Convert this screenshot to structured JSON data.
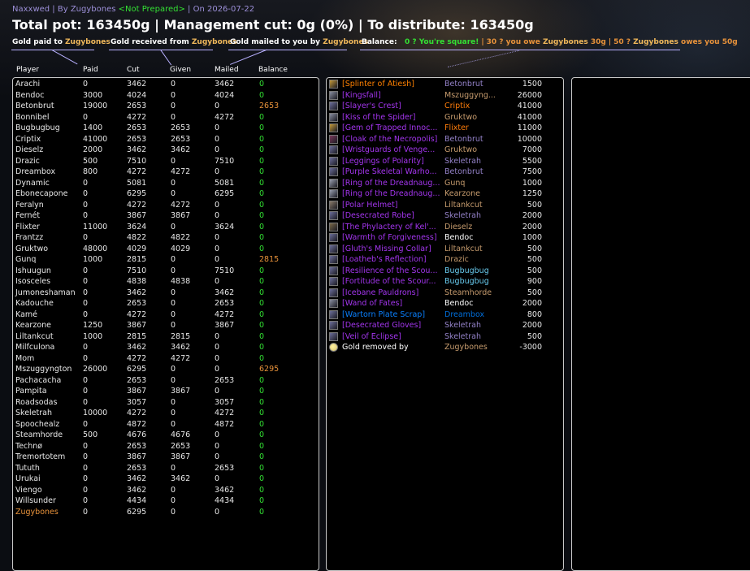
{
  "header": {
    "raid": "Naxxwed",
    "by_prefix": " | By ",
    "leader": "Zugybones",
    "status": "<Not Prepared>",
    "date": " | On 2026-07-22",
    "summary": "Total pot: 163450g | Management cut: 0g (0%) | To distribute: 163450g"
  },
  "legend": {
    "paid_prefix": "Gold paid to ",
    "paid_name": "Zugybones",
    "received_prefix": "Gold received from ",
    "received_name": "Zugybones",
    "mailed_prefix": "Gold mailed to you by ",
    "mailed_name": "Zugybones",
    "balance_label": "Balance:",
    "square": "0 ? You're square!",
    "owe_prefix": "30 ? you owe ",
    "owe_name": "Zugybones",
    "owe_suffix": " 30g",
    "owed_prefix": "50 ? ",
    "owed_name": "Zugybones",
    "owed_suffix": " owes you 50g",
    "sep": "|"
  },
  "columns": {
    "player": "Player",
    "paid": "Paid",
    "cut": "Cut",
    "given": "Given",
    "mailed": "Mailed",
    "balance": "Balance"
  },
  "players": [
    {
      "name": "Arachi",
      "paid": "0",
      "cut": "3462",
      "given": "0",
      "mailed": "3462",
      "balance": "0",
      "bal_color": "green"
    },
    {
      "name": "Bendoc",
      "paid": "3000",
      "cut": "4024",
      "given": "0",
      "mailed": "4024",
      "balance": "0",
      "bal_color": "green"
    },
    {
      "name": "Betonbrut",
      "paid": "19000",
      "cut": "2653",
      "given": "0",
      "mailed": "0",
      "balance": "2653",
      "bal_color": "orange"
    },
    {
      "name": "Bonnibel",
      "paid": "0",
      "cut": "4272",
      "given": "0",
      "mailed": "4272",
      "balance": "0",
      "bal_color": "green"
    },
    {
      "name": "Bugbugbug",
      "paid": "1400",
      "cut": "2653",
      "given": "2653",
      "mailed": "0",
      "balance": "0",
      "bal_color": "green"
    },
    {
      "name": "Criptix",
      "paid": "41000",
      "cut": "2653",
      "given": "2653",
      "mailed": "0",
      "balance": "0",
      "bal_color": "green"
    },
    {
      "name": "Dieselz",
      "paid": "2000",
      "cut": "3462",
      "given": "3462",
      "mailed": "0",
      "balance": "0",
      "bal_color": "green"
    },
    {
      "name": "Drazic",
      "paid": "500",
      "cut": "7510",
      "given": "0",
      "mailed": "7510",
      "balance": "0",
      "bal_color": "green"
    },
    {
      "name": "Dreambox",
      "paid": "800",
      "cut": "4272",
      "given": "4272",
      "mailed": "0",
      "balance": "0",
      "bal_color": "green"
    },
    {
      "name": "Dynamic",
      "paid": "0",
      "cut": "5081",
      "given": "0",
      "mailed": "5081",
      "balance": "0",
      "bal_color": "green"
    },
    {
      "name": "Ebonecapone",
      "paid": "0",
      "cut": "6295",
      "given": "0",
      "mailed": "6295",
      "balance": "0",
      "bal_color": "green"
    },
    {
      "name": "Feralyn",
      "paid": "0",
      "cut": "4272",
      "given": "4272",
      "mailed": "0",
      "balance": "0",
      "bal_color": "green"
    },
    {
      "name": "Fernét",
      "paid": "0",
      "cut": "3867",
      "given": "3867",
      "mailed": "0",
      "balance": "0",
      "bal_color": "green"
    },
    {
      "name": "Flixter",
      "paid": "11000",
      "cut": "3624",
      "given": "0",
      "mailed": "3624",
      "balance": "0",
      "bal_color": "green"
    },
    {
      "name": "Frantzz",
      "paid": "0",
      "cut": "4822",
      "given": "4822",
      "mailed": "0",
      "balance": "0",
      "bal_color": "green"
    },
    {
      "name": "Gruktwo",
      "paid": "48000",
      "cut": "4029",
      "given": "4029",
      "mailed": "0",
      "balance": "0",
      "bal_color": "green"
    },
    {
      "name": "Gunq",
      "paid": "1000",
      "cut": "2815",
      "given": "0",
      "mailed": "0",
      "balance": "2815",
      "bal_color": "orange"
    },
    {
      "name": "Ishuugun",
      "paid": "0",
      "cut": "7510",
      "given": "0",
      "mailed": "7510",
      "balance": "0",
      "bal_color": "green"
    },
    {
      "name": "Isosceles",
      "paid": "0",
      "cut": "4838",
      "given": "4838",
      "mailed": "0",
      "balance": "0",
      "bal_color": "green"
    },
    {
      "name": "Jumoneshaman",
      "paid": "0",
      "cut": "3462",
      "given": "0",
      "mailed": "3462",
      "balance": "0",
      "bal_color": "green"
    },
    {
      "name": "Kadouche",
      "paid": "0",
      "cut": "2653",
      "given": "0",
      "mailed": "2653",
      "balance": "0",
      "bal_color": "green"
    },
    {
      "name": "Kamé",
      "paid": "0",
      "cut": "4272",
      "given": "0",
      "mailed": "4272",
      "balance": "0",
      "bal_color": "green"
    },
    {
      "name": "Kearzone",
      "paid": "1250",
      "cut": "3867",
      "given": "0",
      "mailed": "3867",
      "balance": "0",
      "bal_color": "green"
    },
    {
      "name": "Liltankcut",
      "paid": "1000",
      "cut": "2815",
      "given": "2815",
      "mailed": "0",
      "balance": "0",
      "bal_color": "green"
    },
    {
      "name": "Milfculona",
      "paid": "0",
      "cut": "3462",
      "given": "3462",
      "mailed": "0",
      "balance": "0",
      "bal_color": "green"
    },
    {
      "name": "Mom",
      "paid": "0",
      "cut": "4272",
      "given": "4272",
      "mailed": "0",
      "balance": "0",
      "bal_color": "green"
    },
    {
      "name": "Mszuggyngton",
      "paid": "26000",
      "cut": "6295",
      "given": "0",
      "mailed": "0",
      "balance": "6295",
      "bal_color": "orange"
    },
    {
      "name": "Pachacacha",
      "paid": "0",
      "cut": "2653",
      "given": "0",
      "mailed": "2653",
      "balance": "0",
      "bal_color": "green"
    },
    {
      "name": "Pampita",
      "paid": "0",
      "cut": "3867",
      "given": "3867",
      "mailed": "0",
      "balance": "0",
      "bal_color": "green"
    },
    {
      "name": "Roadsodas",
      "paid": "0",
      "cut": "3057",
      "given": "0",
      "mailed": "3057",
      "balance": "0",
      "bal_color": "green"
    },
    {
      "name": "Skeletrah",
      "paid": "10000",
      "cut": "4272",
      "given": "0",
      "mailed": "4272",
      "balance": "0",
      "bal_color": "green"
    },
    {
      "name": "Spoochealz",
      "paid": "0",
      "cut": "4872",
      "given": "0",
      "mailed": "4872",
      "balance": "0",
      "bal_color": "green"
    },
    {
      "name": "Steamhorde",
      "paid": "500",
      "cut": "4676",
      "given": "4676",
      "mailed": "0",
      "balance": "0",
      "bal_color": "green"
    },
    {
      "name": "Technø",
      "paid": "0",
      "cut": "2653",
      "given": "2653",
      "mailed": "0",
      "balance": "0",
      "bal_color": "green"
    },
    {
      "name": "Tremortotem",
      "paid": "0",
      "cut": "3867",
      "given": "3867",
      "mailed": "0",
      "balance": "0",
      "bal_color": "green"
    },
    {
      "name": "Tututh",
      "paid": "0",
      "cut": "2653",
      "given": "0",
      "mailed": "2653",
      "balance": "0",
      "bal_color": "green"
    },
    {
      "name": "Urukai",
      "paid": "0",
      "cut": "3462",
      "given": "3462",
      "mailed": "0",
      "balance": "0",
      "bal_color": "green"
    },
    {
      "name": "Viengo",
      "paid": "0",
      "cut": "3462",
      "given": "0",
      "mailed": "3462",
      "balance": "0",
      "bal_color": "green"
    },
    {
      "name": "Willsunder",
      "paid": "0",
      "cut": "4434",
      "given": "0",
      "mailed": "4434",
      "balance": "0",
      "bal_color": "green"
    },
    {
      "name": "Zugybones",
      "paid": "0",
      "cut": "6295",
      "given": "0",
      "mailed": "0",
      "balance": "0",
      "bal_color": "green",
      "name_color": "orange"
    }
  ],
  "items": [
    {
      "icon": "gem-icon",
      "name": "[Splinter of Atiesh]",
      "quality": "orange",
      "player": "Betonbrut",
      "player_class": "warlock",
      "value": "1500"
    },
    {
      "icon": "weapon-icon",
      "name": "[Kingsfall]",
      "quality": "purple",
      "player": "Mszuggyng...",
      "player_class": "warrior",
      "value": "26000"
    },
    {
      "icon": "armor-icon",
      "name": "[Slayer's Crest]",
      "quality": "purple",
      "player": "Criptix",
      "player_class": "druid",
      "value": "41000"
    },
    {
      "icon": "weapon-icon",
      "name": "[Kiss of the Spider]",
      "quality": "purple",
      "player": "Gruktwo",
      "player_class": "warrior",
      "value": "41000"
    },
    {
      "icon": "gem-icon",
      "name": "[Gem of Trapped Innoc...",
      "quality": "purple",
      "player": "Flixter",
      "player_class": "druid",
      "value": "11000"
    },
    {
      "icon": "cloak-icon",
      "name": "[Cloak of the Necropolis]",
      "quality": "purple",
      "player": "Betonbrut",
      "player_class": "warlock",
      "value": "10000"
    },
    {
      "icon": "armor-icon",
      "name": "[Wristguards of Venge...",
      "quality": "purple",
      "player": "Gruktwo",
      "player_class": "warrior",
      "value": "7000"
    },
    {
      "icon": "armor-icon",
      "name": "[Leggings of Polarity]",
      "quality": "purple",
      "player": "Skeletrah",
      "player_class": "warlock",
      "value": "5500"
    },
    {
      "icon": "armor-icon",
      "name": "[Purple Skeletal Warho...",
      "quality": "purple",
      "player": "Betonbrut",
      "player_class": "warlock",
      "value": "7500"
    },
    {
      "icon": "ring-icon",
      "name": "[Ring of the Dreadnaug...",
      "quality": "purple",
      "player": "Gunq",
      "player_class": "warrior",
      "value": "1000"
    },
    {
      "icon": "ring-icon",
      "name": "[Ring of the Dreadnaug...",
      "quality": "purple",
      "player": "Kearzone",
      "player_class": "warrior",
      "value": "1250"
    },
    {
      "icon": "helmet-icon",
      "name": "[Polar Helmet]",
      "quality": "purple",
      "player": "Liltankcut",
      "player_class": "warrior",
      "value": "500"
    },
    {
      "icon": "armor-icon",
      "name": "[Desecrated Robe]",
      "quality": "purple",
      "player": "Skeletrah",
      "player_class": "warlock",
      "value": "2000"
    },
    {
      "icon": "scroll-icon",
      "name": "[The Phylactery of Kel'...",
      "quality": "purple",
      "player": "Dieselz",
      "player_class": "warrior",
      "value": "2000"
    },
    {
      "icon": "armor-icon",
      "name": "[Warmth of Forgiveness]",
      "quality": "purple",
      "player": "Bendoc",
      "player_class": "priest",
      "value": "1000"
    },
    {
      "icon": "armor-icon",
      "name": "[Gluth's Missing Collar]",
      "quality": "purple",
      "player": "Liltankcut",
      "player_class": "warrior",
      "value": "500"
    },
    {
      "icon": "armor-icon",
      "name": "[Loatheb's Reflection]",
      "quality": "purple",
      "player": "Drazic",
      "player_class": "warrior",
      "value": "500"
    },
    {
      "icon": "armor-icon",
      "name": "[Resilience of the Scou...",
      "quality": "purple",
      "player": "Bugbugbug",
      "player_class": "mage",
      "value": "500"
    },
    {
      "icon": "armor-icon",
      "name": "[Fortitude of the Scour...",
      "quality": "purple",
      "player": "Bugbugbug",
      "player_class": "mage",
      "value": "900"
    },
    {
      "icon": "armor-icon",
      "name": "[Icebane Pauldrons]",
      "quality": "purple",
      "player": "Steamhorde",
      "player_class": "warrior",
      "value": "500"
    },
    {
      "icon": "weapon-icon",
      "name": "[Wand of Fates]",
      "quality": "purple",
      "player": "Bendoc",
      "player_class": "priest",
      "value": "2000"
    },
    {
      "icon": "armor-icon",
      "name": "[Wartorn Plate Scrap]",
      "quality": "blue",
      "player": "Dreambox",
      "player_class": "shaman",
      "value": "800"
    },
    {
      "icon": "armor-icon",
      "name": "[Desecrated Gloves]",
      "quality": "purple",
      "player": "Skeletrah",
      "player_class": "warlock",
      "value": "2000"
    },
    {
      "icon": "armor-icon",
      "name": "[Veil of Eclipse]",
      "quality": "purple",
      "player": "Skeletrah",
      "player_class": "warlock",
      "value": "500"
    },
    {
      "icon": "coin-icon",
      "name": "Gold removed by",
      "quality": "white",
      "player": "Zugybones",
      "player_class": "warrior",
      "value": "-3000"
    }
  ],
  "colors": {
    "panel_border": "#c8c8c8",
    "green": "#33e033",
    "orange": "#e8923a",
    "epic": "#a335ee",
    "legendary": "#ff8000",
    "rare": "#0a80ff"
  }
}
